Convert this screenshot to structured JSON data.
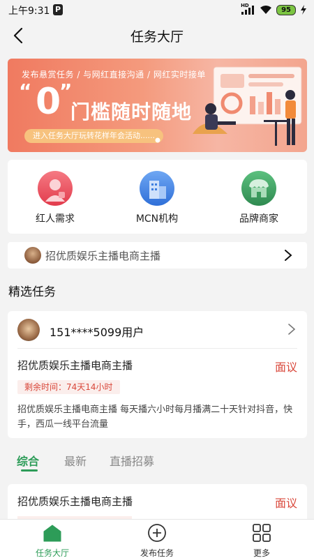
{
  "status_bar": {
    "time": "上午9:31",
    "app_icon_letter": "P",
    "network": "HD",
    "battery": "95"
  },
  "header": {
    "title": "任务大厅"
  },
  "banner": {
    "tagline": "发布悬赏任务 / 与网红直接沟通 / 网红实时接单",
    "zero": "0",
    "headline": "门槛随时随地",
    "cta": "进入任务大厅玩转花样年会活动......"
  },
  "categories": [
    {
      "label": "红人需求",
      "icon": "person-icon",
      "color": "#e84a5a"
    },
    {
      "label": "MCN机构",
      "icon": "building-icon",
      "color": "#3e7fe0"
    },
    {
      "label": "品牌商家",
      "icon": "shop-icon",
      "color": "#3a9a5c"
    }
  ],
  "notice": {
    "text": "招优质娱乐主播电商主播"
  },
  "featured": {
    "section_title": "精选任务",
    "user": "151****5099用户",
    "task_title": "招优质娱乐主播电商主播",
    "price": "面议",
    "remaining": "剩余时间：74天14小时",
    "description": "招优质娱乐主播电商主播 每天播六小时每月播满二十天针对抖音，快手，西瓜一线平台流量"
  },
  "tabs": [
    {
      "label": "综合",
      "active": true
    },
    {
      "label": "最新",
      "active": false
    },
    {
      "label": "直播招募",
      "active": false
    }
  ],
  "list": [
    {
      "task_title": "招优质娱乐主播电商主播",
      "price": "面议"
    }
  ],
  "bottom_nav": [
    {
      "label": "任务大厅",
      "icon": "home-icon",
      "active": true
    },
    {
      "label": "发布任务",
      "icon": "plus-circle-icon",
      "active": false
    },
    {
      "label": "更多",
      "icon": "grid-icon",
      "active": false
    }
  ],
  "colors": {
    "accent": "#2d9c58",
    "price": "#d9473a"
  }
}
